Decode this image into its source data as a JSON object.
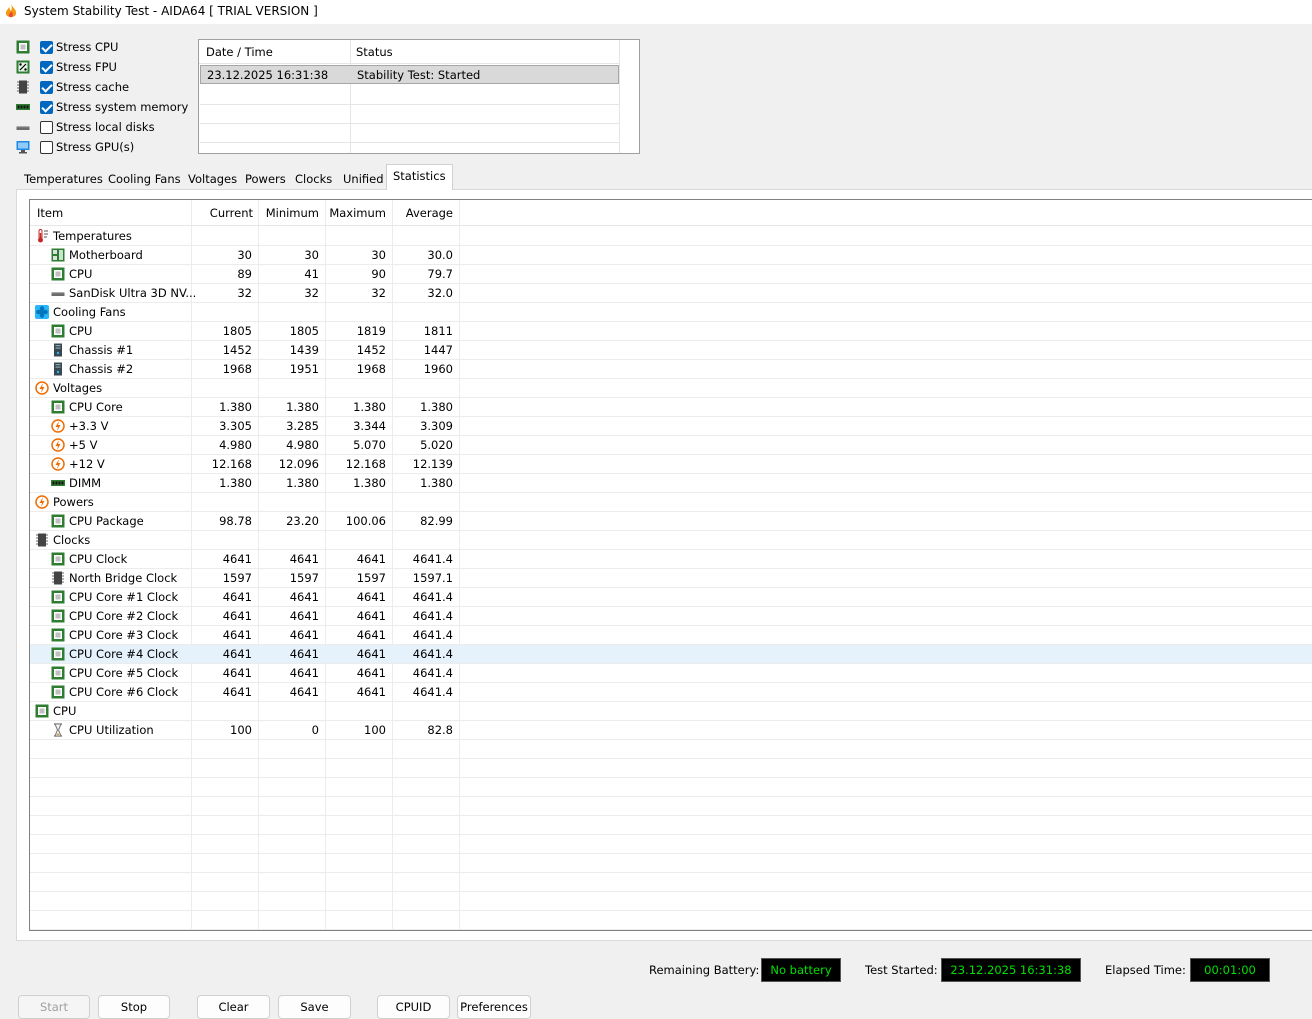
{
  "window": {
    "title": "System Stability Test - AIDA64  [ TRIAL VERSION ]"
  },
  "stress_options": [
    {
      "label": "Stress CPU",
      "checked": true,
      "icon": "cpu-chip-icon"
    },
    {
      "label": "Stress FPU",
      "checked": true,
      "icon": "fpu-icon"
    },
    {
      "label": "Stress cache",
      "checked": true,
      "icon": "cache-icon"
    },
    {
      "label": "Stress system memory",
      "checked": true,
      "icon": "memory-icon"
    },
    {
      "label": "Stress local disks",
      "checked": false,
      "icon": "disk-icon"
    },
    {
      "label": "Stress GPU(s)",
      "checked": false,
      "icon": "monitor-icon"
    }
  ],
  "status_log": {
    "headers": [
      "Date / Time",
      "Status"
    ],
    "rows": [
      {
        "datetime": "23.12.2025 16:31:38",
        "status": "Stability Test: Started"
      }
    ]
  },
  "tabs": [
    "Temperatures",
    "Cooling Fans",
    "Voltages",
    "Powers",
    "Clocks",
    "Unified",
    "Statistics"
  ],
  "active_tab": "Statistics",
  "stats": {
    "headers": [
      "Item",
      "Current",
      "Minimum",
      "Maximum",
      "Average"
    ],
    "rows": [
      {
        "group": true,
        "label": "Temperatures",
        "icon": "thermometer-icon"
      },
      {
        "label": "Motherboard",
        "icon": "motherboard-icon",
        "cur": "30",
        "min": "30",
        "max": "30",
        "avg": "30.0"
      },
      {
        "label": "CPU",
        "icon": "cpu-chip-icon",
        "cur": "89",
        "min": "41",
        "max": "90",
        "avg": "79.7"
      },
      {
        "label": "SanDisk Ultra 3D NV...",
        "icon": "disk-icon",
        "cur": "32",
        "min": "32",
        "max": "32",
        "avg": "32.0"
      },
      {
        "group": true,
        "label": "Cooling Fans",
        "icon": "fan-icon"
      },
      {
        "label": "CPU",
        "icon": "cpu-chip-icon",
        "cur": "1805",
        "min": "1805",
        "max": "1819",
        "avg": "1811"
      },
      {
        "label": "Chassis #1",
        "icon": "chassis-icon",
        "cur": "1452",
        "min": "1439",
        "max": "1452",
        "avg": "1447"
      },
      {
        "label": "Chassis #2",
        "icon": "chassis-icon",
        "cur": "1968",
        "min": "1951",
        "max": "1968",
        "avg": "1960"
      },
      {
        "group": true,
        "label": "Voltages",
        "icon": "voltage-icon"
      },
      {
        "label": "CPU Core",
        "icon": "cpu-chip-icon",
        "cur": "1.380",
        "min": "1.380",
        "max": "1.380",
        "avg": "1.380"
      },
      {
        "label": "+3.3 V",
        "icon": "voltage-icon",
        "cur": "3.305",
        "min": "3.285",
        "max": "3.344",
        "avg": "3.309"
      },
      {
        "label": "+5 V",
        "icon": "voltage-icon",
        "cur": "4.980",
        "min": "4.980",
        "max": "5.070",
        "avg": "5.020"
      },
      {
        "label": "+12 V",
        "icon": "voltage-icon",
        "cur": "12.168",
        "min": "12.096",
        "max": "12.168",
        "avg": "12.139"
      },
      {
        "label": "DIMM",
        "icon": "memory-icon",
        "cur": "1.380",
        "min": "1.380",
        "max": "1.380",
        "avg": "1.380"
      },
      {
        "group": true,
        "label": "Powers",
        "icon": "voltage-icon"
      },
      {
        "label": "CPU Package",
        "icon": "cpu-chip-icon",
        "cur": "98.78",
        "min": "23.20",
        "max": "100.06",
        "avg": "82.99"
      },
      {
        "group": true,
        "label": "Clocks",
        "icon": "cache-icon"
      },
      {
        "label": "CPU Clock",
        "icon": "cpu-chip-icon",
        "cur": "4641",
        "min": "4641",
        "max": "4641",
        "avg": "4641.4"
      },
      {
        "label": "North Bridge Clock",
        "icon": "cache-icon",
        "cur": "1597",
        "min": "1597",
        "max": "1597",
        "avg": "1597.1"
      },
      {
        "label": "CPU Core #1 Clock",
        "icon": "cpu-chip-icon",
        "cur": "4641",
        "min": "4641",
        "max": "4641",
        "avg": "4641.4"
      },
      {
        "label": "CPU Core #2 Clock",
        "icon": "cpu-chip-icon",
        "cur": "4641",
        "min": "4641",
        "max": "4641",
        "avg": "4641.4"
      },
      {
        "label": "CPU Core #3 Clock",
        "icon": "cpu-chip-icon",
        "cur": "4641",
        "min": "4641",
        "max": "4641",
        "avg": "4641.4"
      },
      {
        "label": "CPU Core #4 Clock",
        "icon": "cpu-chip-icon",
        "cur": "4641",
        "min": "4641",
        "max": "4641",
        "avg": "4641.4",
        "selected": true
      },
      {
        "label": "CPU Core #5 Clock",
        "icon": "cpu-chip-icon",
        "cur": "4641",
        "min": "4641",
        "max": "4641",
        "avg": "4641.4"
      },
      {
        "label": "CPU Core #6 Clock",
        "icon": "cpu-chip-icon",
        "cur": "4641",
        "min": "4641",
        "max": "4641",
        "avg": "4641.4"
      },
      {
        "group": true,
        "label": "CPU",
        "icon": "cpu-chip-icon"
      },
      {
        "label": "CPU Utilization",
        "icon": "hourglass-icon",
        "cur": "100",
        "min": "0",
        "max": "100",
        "avg": "82.8"
      }
    ]
  },
  "footer": {
    "battery_label": "Remaining Battery:",
    "battery_value": "No battery",
    "started_label": "Test Started:",
    "started_value": "23.12.2025 16:31:38",
    "elapsed_label": "Elapsed Time:",
    "elapsed_value": "00:01:00"
  },
  "buttons": {
    "start": "Start",
    "stop": "Stop",
    "clear": "Clear",
    "save": "Save",
    "cpuid": "CPUID",
    "preferences": "Preferences"
  },
  "colors": {
    "cpu_green": "#3a8a3a",
    "led_green": "#00e000",
    "selection": "#e5f1fb",
    "checkbox_blue": "#0067c0"
  }
}
